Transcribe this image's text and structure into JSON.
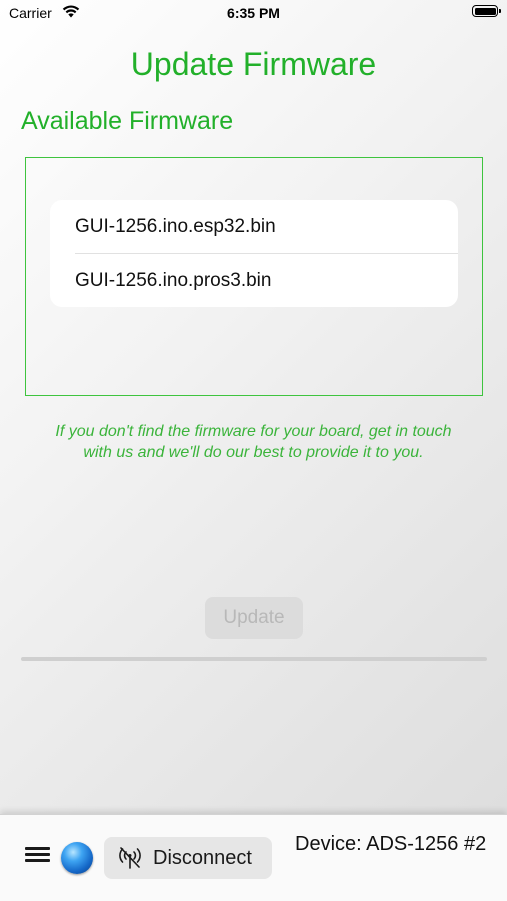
{
  "status_bar": {
    "carrier": "Carrier",
    "time": "6:35 PM",
    "wifi_icon": "wifi-icon",
    "battery_icon": "battery-icon"
  },
  "title": "Update Firmware",
  "available_section": {
    "heading": "Available Firmware",
    "items": [
      {
        "label": "GUI-1256.ino.esp32.bin"
      },
      {
        "label": "GUI-1256.ino.pros3.bin"
      }
    ]
  },
  "hint": "If you don't find the firmware for your board, get in touch with us and we'll do our best to provide it to you.",
  "update_button": {
    "label": "Update",
    "enabled": false
  },
  "progress": {
    "value": 0
  },
  "bottom_bar": {
    "menu_icon": "hamburger-menu-icon",
    "status_indicator_color": "#1e6fd0",
    "disconnect_icon": "antenna-off-icon",
    "disconnect_label": "Disconnect",
    "device_label": "Device: ADS-1256 #2"
  },
  "colors": {
    "accent_green": "#22b02a",
    "frame_green": "#3ec43e"
  }
}
